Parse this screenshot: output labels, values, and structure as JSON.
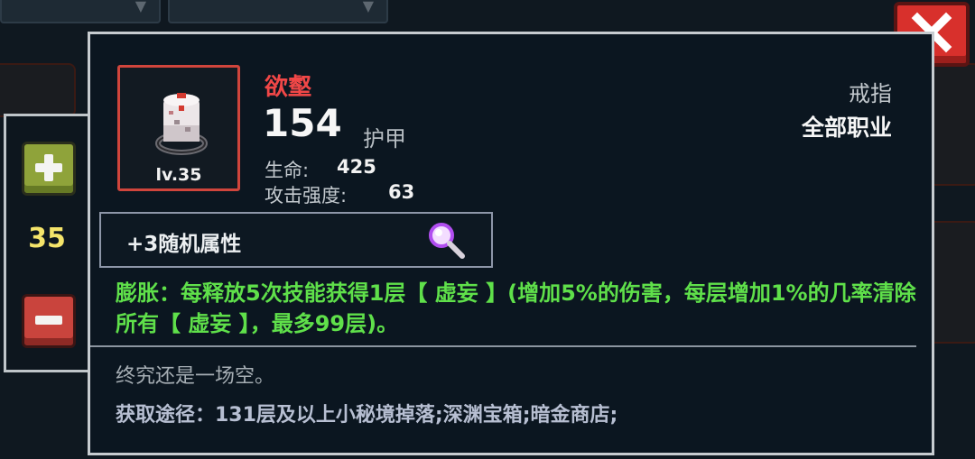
{
  "close_icon": "close-icon",
  "stepper": {
    "count": "35",
    "plus_icon": "plus-icon",
    "minus_icon": "minus-icon",
    "plus_color": "#8fa33a",
    "minus_color": "#c9443d"
  },
  "item": {
    "name": "欲壑",
    "name_color": "#f04747",
    "level": "lv.35",
    "power": "154",
    "power_label": "护甲",
    "slot": "戒指",
    "class": "全部职业",
    "stats": [
      {
        "label": "生命:",
        "value": "425"
      },
      {
        "label": "攻击强度:",
        "value": "63"
      }
    ],
    "random_attr": "+3随机属性",
    "skill": "膨胀：每释放5次技能获得1层【 虚妄 】(增加5%的伤害，每层增加1%的几率清除所有【 虚妄 】，最多99层)。",
    "skill_color": "#5fe04a",
    "flavor": "终究还是一场空。",
    "source": "获取途径：131层及以上小秘境掉落;深渊宝箱;暗金商店;"
  }
}
